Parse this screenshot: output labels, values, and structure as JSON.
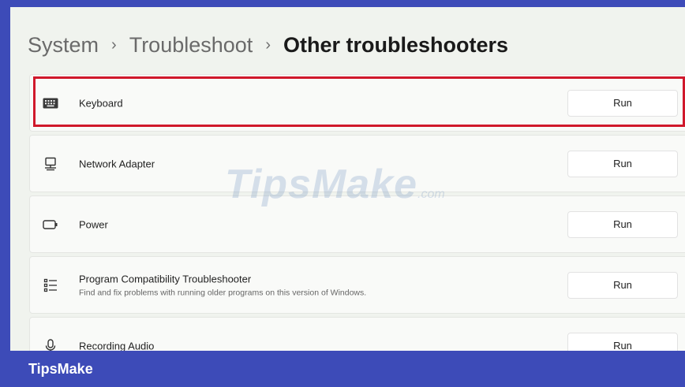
{
  "breadcrumb": {
    "items": [
      "System",
      "Troubleshoot"
    ],
    "separator": "›",
    "current": "Other troubleshooters"
  },
  "troubleshooters": [
    {
      "icon": "keyboard-icon",
      "title": "Keyboard",
      "description": "",
      "button": "Run"
    },
    {
      "icon": "network-adapter-icon",
      "title": "Network Adapter",
      "description": "",
      "button": "Run"
    },
    {
      "icon": "battery-icon",
      "title": "Power",
      "description": "",
      "button": "Run"
    },
    {
      "icon": "list-icon",
      "title": "Program Compatibility Troubleshooter",
      "description": "Find and fix problems with running older programs on this version of Windows.",
      "button": "Run"
    },
    {
      "icon": "microphone-icon",
      "title": "Recording Audio",
      "description": "",
      "button": "Run"
    }
  ],
  "watermark": {
    "text": "TipsMake",
    "domain": ".com"
  },
  "footer": {
    "brand": "TipsMake"
  },
  "colors": {
    "highlight_border": "#d0182b",
    "footer_background": "#3d4bb8",
    "content_background": "#f0f3ee"
  }
}
